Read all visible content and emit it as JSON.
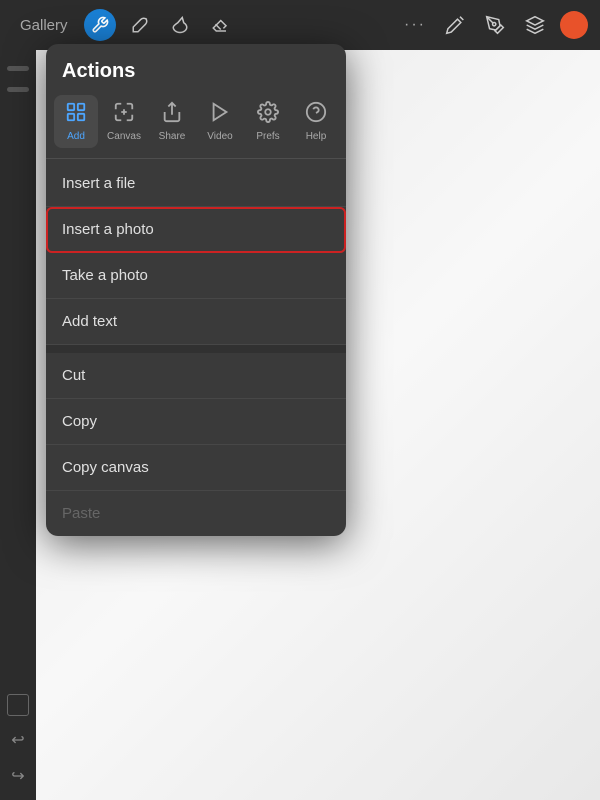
{
  "toolbar": {
    "gallery_label": "Gallery",
    "more_icon": "···",
    "tools": [
      "pencil",
      "pen",
      "eraser",
      "layers"
    ]
  },
  "panel": {
    "title": "Actions",
    "tabs": [
      {
        "id": "add",
        "label": "Add",
        "icon": "⊞",
        "active": true
      },
      {
        "id": "canvas",
        "label": "Canvas",
        "icon": "⬚"
      },
      {
        "id": "share",
        "label": "Share",
        "icon": "↑"
      },
      {
        "id": "video",
        "label": "Video",
        "icon": "▶"
      },
      {
        "id": "prefs",
        "label": "Prefs",
        "icon": "◑"
      },
      {
        "id": "help",
        "label": "Help",
        "icon": "?"
      }
    ],
    "menu_items": [
      {
        "id": "insert-file",
        "label": "Insert a file",
        "highlighted": false,
        "disabled": false,
        "section": 1
      },
      {
        "id": "insert-photo",
        "label": "Insert a photo",
        "highlighted": true,
        "disabled": false,
        "section": 1
      },
      {
        "id": "take-photo",
        "label": "Take a photo",
        "highlighted": false,
        "disabled": false,
        "section": 1
      },
      {
        "id": "add-text",
        "label": "Add text",
        "highlighted": false,
        "disabled": false,
        "section": 1
      },
      {
        "id": "cut",
        "label": "Cut",
        "highlighted": false,
        "disabled": false,
        "section": 2
      },
      {
        "id": "copy",
        "label": "Copy",
        "highlighted": false,
        "disabled": false,
        "section": 2
      },
      {
        "id": "copy-canvas",
        "label": "Copy canvas",
        "highlighted": false,
        "disabled": false,
        "section": 2
      },
      {
        "id": "paste",
        "label": "Paste",
        "highlighted": false,
        "disabled": true,
        "section": 2
      }
    ]
  }
}
